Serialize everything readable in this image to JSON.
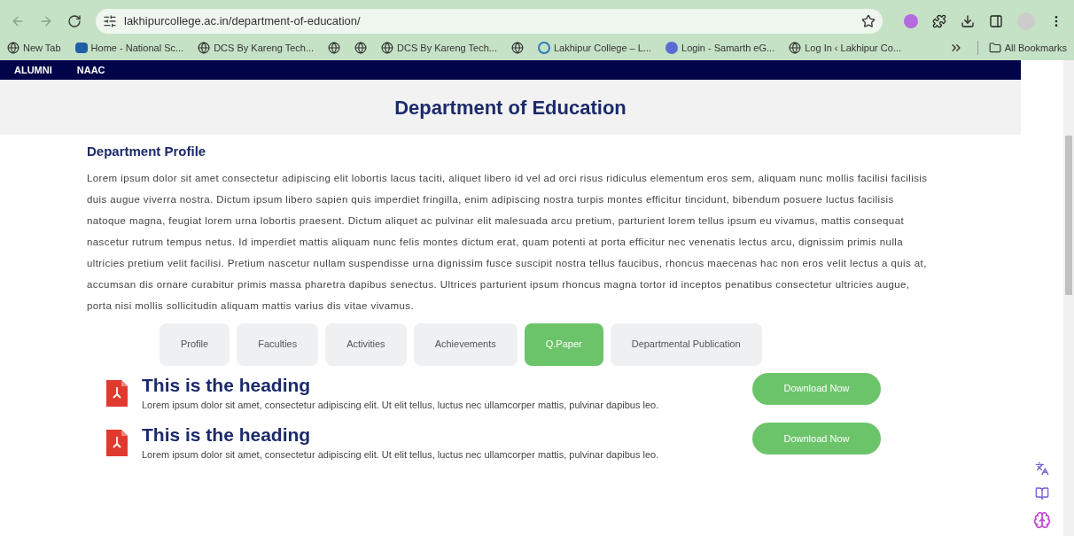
{
  "browser": {
    "url": "lakhipurcollege.ac.in/department-of-education/",
    "bookmarks": [
      {
        "label": "New Tab",
        "kind": "globe"
      },
      {
        "label": "Home - National Sc...",
        "kind": "nsc"
      },
      {
        "label": "DCS By Kareng Tech...",
        "kind": "globe"
      },
      {
        "kind": "globe"
      },
      {
        "kind": "globe"
      },
      {
        "label": "DCS By Kareng Tech...",
        "kind": "globe"
      },
      {
        "kind": "globe"
      },
      {
        "label": "Lakhipur College – L...",
        "kind": "wp"
      },
      {
        "label": "Login - Samarth eG...",
        "kind": "s"
      },
      {
        "label": "Log In ‹ Lakhipur Co...",
        "kind": "globe"
      }
    ],
    "all_bookmarks": "All Bookmarks"
  },
  "nav": {
    "items": [
      "ALUMNI",
      "NAAC"
    ]
  },
  "page_title": "Department of Education",
  "profile": {
    "heading": "Department Profile",
    "text": "Lorem ipsum dolor sit amet consectetur adipiscing elit lobortis lacus taciti, aliquet libero id vel ad orci risus ridiculus elementum eros sem, aliquam nunc mollis facilisi facilisis duis augue viverra nostra. Dictum ipsum libero sapien quis imperdiet fringilla, enim adipiscing nostra turpis montes efficitur tincidunt, bibendum posuere luctus facilisis natoque magna, feugiat lorem urna lobortis praesent. Dictum aliquet ac pulvinar elit malesuada arcu pretium, parturient lorem tellus ipsum eu vivamus, mattis consequat nascetur rutrum tempus netus. Id imperdiet mattis aliquam nunc felis montes dictum erat, quam potenti at porta efficitur nec venenatis lectus arcu, dignissim primis nulla ultricies pretium velit facilisi. Pretium nascetur nullam suspendisse urna dignissim fusce suscipit nostra tellus faucibus, rhoncus maecenas hac non eros velit lectus a quis at, accumsan dis ornare curabitur primis massa pharetra dapibus senectus. Ultrices parturient ipsum rhoncus magna tortor id inceptos penatibus consectetur ultricies augue, porta nisi mollis sollicitudin aliquam mattis varius dis vitae vivamus."
  },
  "tabs": [
    {
      "label": "Profile",
      "selected": false
    },
    {
      "label": "Faculties",
      "selected": false
    },
    {
      "label": "Activities",
      "selected": false
    },
    {
      "label": "Achievements",
      "selected": false
    },
    {
      "label": "Q.Paper",
      "selected": true
    },
    {
      "label": "Departmental Publication",
      "selected": false
    }
  ],
  "documents": [
    {
      "heading": "This is the heading",
      "text": "Lorem ipsum dolor sit amet, consectetur adipiscing elit. Ut elit tellus, luctus nec ullamcorper mattis, pulvinar dapibus leo.",
      "button": "Download Now"
    },
    {
      "heading": "This is the heading",
      "text": "Lorem ipsum dolor sit amet, consectetur adipiscing elit. Ut elit tellus, luctus nec ullamcorper mattis, pulvinar dapibus leo.",
      "button": "Download Now"
    }
  ]
}
